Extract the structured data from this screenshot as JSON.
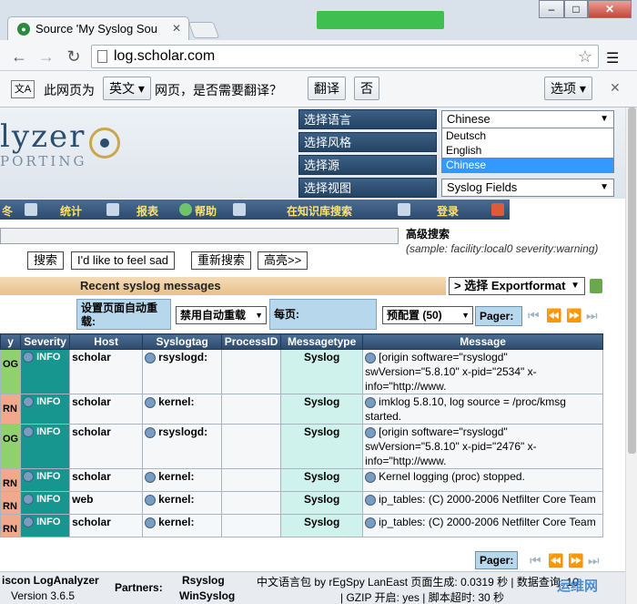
{
  "browser": {
    "tab_title": "Source 'My Syslog Sou",
    "url": "log.scholar.com",
    "translate_prompt_prefix": "此网页为",
    "translate_lang": "英文",
    "translate_prompt_suffix": "网页，是否需要翻译？",
    "translate_button": "翻译",
    "no_button": "否",
    "options_button": "选项"
  },
  "header": {
    "logo_text": "lyzer",
    "logo_sub": "PORTING",
    "labels": [
      "选择语言",
      "选择风格",
      "选择源",
      "选择视图"
    ],
    "language_value": "Chinese",
    "language_options": [
      "Deutsch",
      "English",
      "Chinese"
    ],
    "view_value": "Syslog Fields"
  },
  "nav": {
    "items": [
      "统计",
      "报表",
      "帮助",
      "在知识库搜索",
      "登录"
    ]
  },
  "search": {
    "advanced": "高级搜索",
    "sample": "(sample: facility:local0 severity:warning)",
    "buttons": [
      "搜索",
      "I'd like to feel sad",
      "重新搜索",
      "高亮>>"
    ]
  },
  "messages": {
    "title": "Recent syslog messages",
    "export": "> 选择 Exportformat",
    "auto_reload_label": "设置页面自动重载:",
    "auto_reload_value": "禁用自动重载",
    "per_page_label": "每页:",
    "per_page_value": "预配置 (50)",
    "pager_label": "Pager:"
  },
  "table": {
    "headers": [
      "y",
      "Severity",
      "Host",
      "Syslogtag",
      "ProcessID",
      "Messagetype",
      "Message"
    ],
    "rows": [
      {
        "fac": "OG",
        "sev": "INFO",
        "host": "scholar",
        "tag": "rsyslogd:",
        "pid": "",
        "mtype": "Syslog",
        "msg": "[origin software=\"rsyslogd\" swVersion=\"5.8.10\" x-pid=\"2534\" x-info=\"http://www.",
        "kern": false
      },
      {
        "fac": "RN",
        "sev": "INFO",
        "host": "scholar",
        "tag": "kernel:",
        "pid": "",
        "mtype": "Syslog",
        "msg": "imklog 5.8.10, log source = /proc/kmsg started.",
        "kern": true
      },
      {
        "fac": "OG",
        "sev": "INFO",
        "host": "scholar",
        "tag": "rsyslogd:",
        "pid": "",
        "mtype": "Syslog",
        "msg": "[origin software=\"rsyslogd\" swVersion=\"5.8.10\" x-pid=\"2476\" x-info=\"http://www.",
        "kern": false
      },
      {
        "fac": "RN",
        "sev": "INFO",
        "host": "scholar",
        "tag": "kernel:",
        "pid": "",
        "mtype": "Syslog",
        "msg": "Kernel logging (proc) stopped.",
        "kern": true
      },
      {
        "fac": "RN",
        "sev": "INFO",
        "host": "web",
        "tag": "kernel:",
        "pid": "",
        "mtype": "Syslog",
        "msg": "ip_tables: (C) 2000-2006 Netfilter Core Team",
        "kern": true
      },
      {
        "fac": "RN",
        "sev": "INFO",
        "host": "scholar",
        "tag": "kernel:",
        "pid": "",
        "mtype": "Syslog",
        "msg": "ip_tables: (C) 2000-2006 Netfilter Core Team",
        "kern": true
      }
    ]
  },
  "footer": {
    "product": "iscon LogAnalyzer",
    "version": "Version 3.6.5",
    "partners_label": "Partners:",
    "partner1": "Rsyslog",
    "partner2": "WinSyslog",
    "line1": "中文语言包 by rEgSpy LanEast 页面生成: 0.0319 秒 | 数据查询: 10",
    "line2": "| GZIP 开启: yes | 脚本超时: 30 秒",
    "watermark": "运维网"
  }
}
